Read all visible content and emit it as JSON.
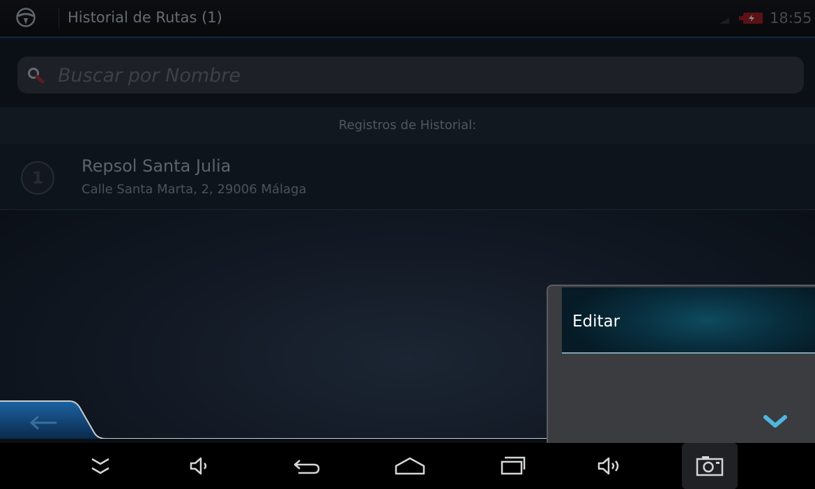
{
  "status_bar": {
    "app_icon": "steering-wheel-icon",
    "title": "Historial de Rutas (1)",
    "time": "18:55",
    "signal_icon": "signal-icon",
    "battery_icon": "battery-charging-icon"
  },
  "search": {
    "icon": "search-icon",
    "placeholder": "Buscar por Nombre",
    "value": ""
  },
  "history": {
    "header": "Registros de Historial:",
    "items": [
      {
        "index": "1",
        "name": "Repsol Santa Julia",
        "address": "Calle Santa Marta, 2, 29006 Málaga"
      }
    ]
  },
  "popup_menu": {
    "items": [
      {
        "label": "Editar"
      }
    ]
  },
  "bottom_bar": {
    "back_icon": "back-arrow-icon",
    "menu_icon": "chevron-down-icon"
  },
  "nav_bar": {
    "buttons": [
      "collapse-icon",
      "volume-down-icon",
      "back-icon",
      "home-icon",
      "recents-icon",
      "volume-up-icon",
      "screenshot-icon"
    ]
  },
  "colors": {
    "accent": "#1e7fc6",
    "chevron": "#4fb6e0",
    "popup_highlight": "#0e4a5e",
    "background": "#121924"
  }
}
